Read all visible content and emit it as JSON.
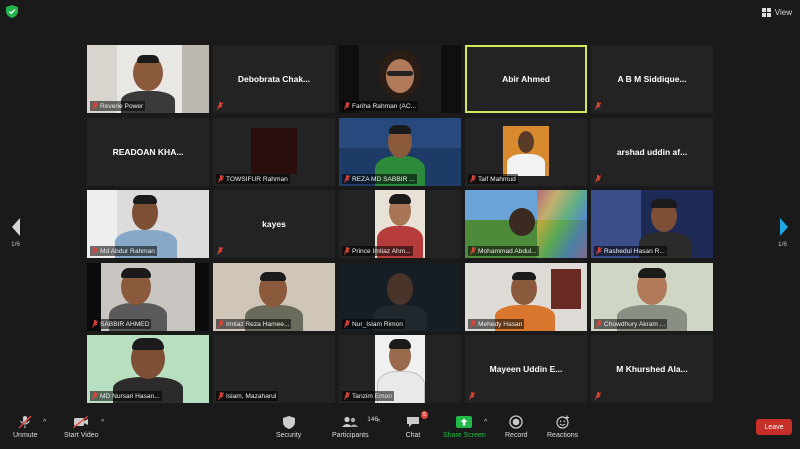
{
  "top": {
    "view_label": "View"
  },
  "colors": {
    "active_border": "#d6e65a",
    "leave_bg": "#c52f27",
    "share_green": "#20b849",
    "muted_red": "#e0453a"
  },
  "nav": {
    "left_page": "1/6",
    "right_page": "1/6"
  },
  "tiles": [
    {
      "label": "Reverie Power",
      "name": ""
    },
    {
      "label": "",
      "name": "Debobrata  Chak..."
    },
    {
      "label": "Fariha Rahman (AC...",
      "name": ""
    },
    {
      "label": "",
      "name": "Abir Ahmed"
    },
    {
      "label": "",
      "name": "A  B  M  Siddique..."
    },
    {
      "label": "",
      "name": "READOAN  KHA..."
    },
    {
      "label": "TOWSIFUR Rahman",
      "name": ""
    },
    {
      "label": "REZA MD SABBIR ...",
      "name": ""
    },
    {
      "label": "Taif Mahmud",
      "name": ""
    },
    {
      "label": "",
      "name": "arshad  uddin  af..."
    },
    {
      "label": "Md Abdur Rahman",
      "name": ""
    },
    {
      "label": "",
      "name": "kayes"
    },
    {
      "label": "Prince  Imtiaz Ahm...",
      "name": ""
    },
    {
      "label": "Mohammad Abdul...",
      "name": ""
    },
    {
      "label": "Rashedul Hasan R...",
      "name": ""
    },
    {
      "label": "SABBIR AHMED",
      "name": ""
    },
    {
      "label": "Imtiaz Reza Hamee...",
      "name": ""
    },
    {
      "label": "Nur_Islam Rimon",
      "name": ""
    },
    {
      "label": "Mehedy Hasan",
      "name": ""
    },
    {
      "label": "Chowdhury Akram ...",
      "name": ""
    },
    {
      "label": "MD Nursari Hasan...",
      "name": ""
    },
    {
      "label": "Islam, Mazaharul",
      "name": ""
    },
    {
      "label": "Tanzim Emon",
      "name": ""
    },
    {
      "label": "",
      "name": "Mayeen  Uddin  E..."
    },
    {
      "label": "",
      "name": "M  Khurshed  Ala..."
    }
  ],
  "toolbar": {
    "unmute": "Unmute",
    "start_video": "Start Video",
    "security": "Security",
    "participants": "Participants",
    "participants_count": "146",
    "chat": "Chat",
    "chat_badge": "5",
    "share_screen": "Share Screen",
    "record": "Record",
    "reactions": "Reactions",
    "leave": "Leave"
  }
}
